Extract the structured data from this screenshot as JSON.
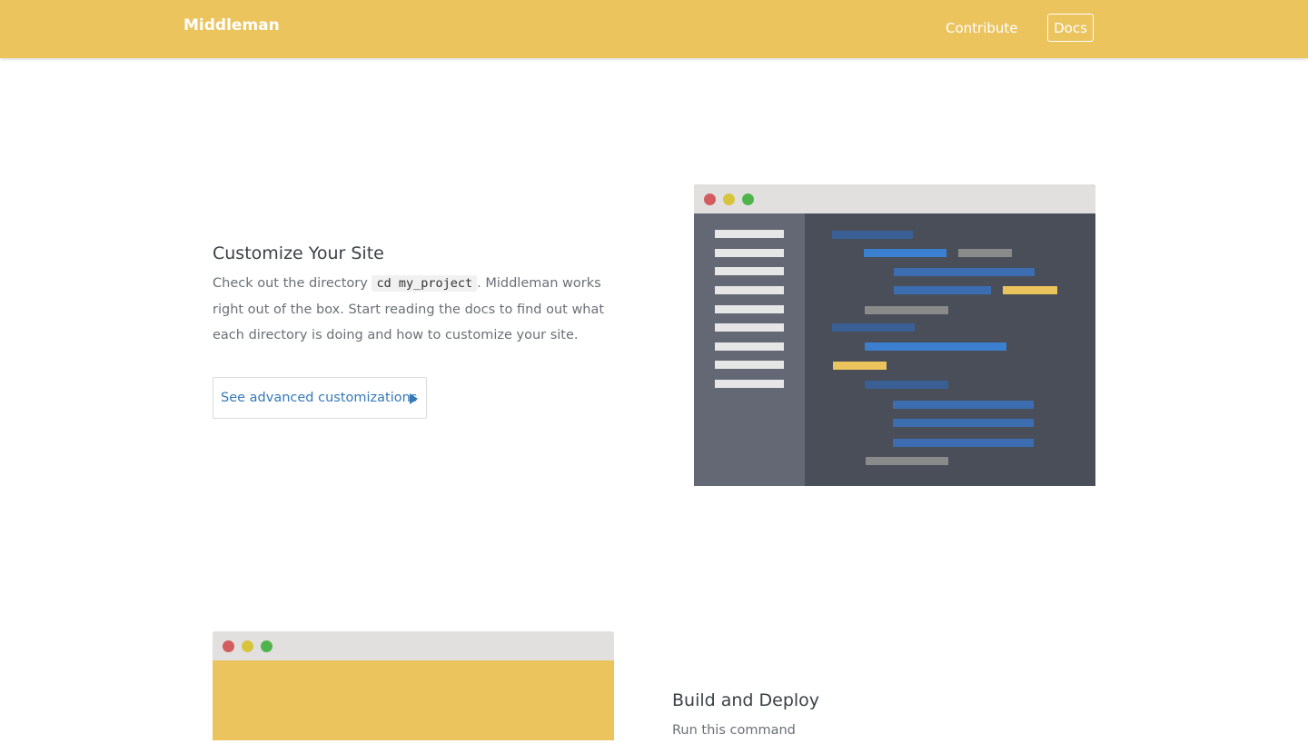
{
  "header": {
    "brand": "Middleman",
    "nav": {
      "contribute": "Contribute",
      "docs": "Docs"
    }
  },
  "customize": {
    "title": "Customize Your Site",
    "desc_before": "Check out the directory ",
    "code": "cd my_project",
    "desc_after": ". Middleman works right out of the box. Start reading the docs to find out what each directory is doing and how to customize your site.",
    "cta_label": "See advanced customizations"
  },
  "build": {
    "title": "Build and Deploy",
    "desc_before": "Run  this  command "
  },
  "colors": {
    "brand_yellow": "#ebc45e",
    "link_blue": "#3479b8",
    "editor_bg": "#4a4e58",
    "editor_sidebar": "#646874"
  },
  "icons": [
    "window-close-dot",
    "window-minimize-dot",
    "window-zoom-dot",
    "triangle-right-icon"
  ]
}
